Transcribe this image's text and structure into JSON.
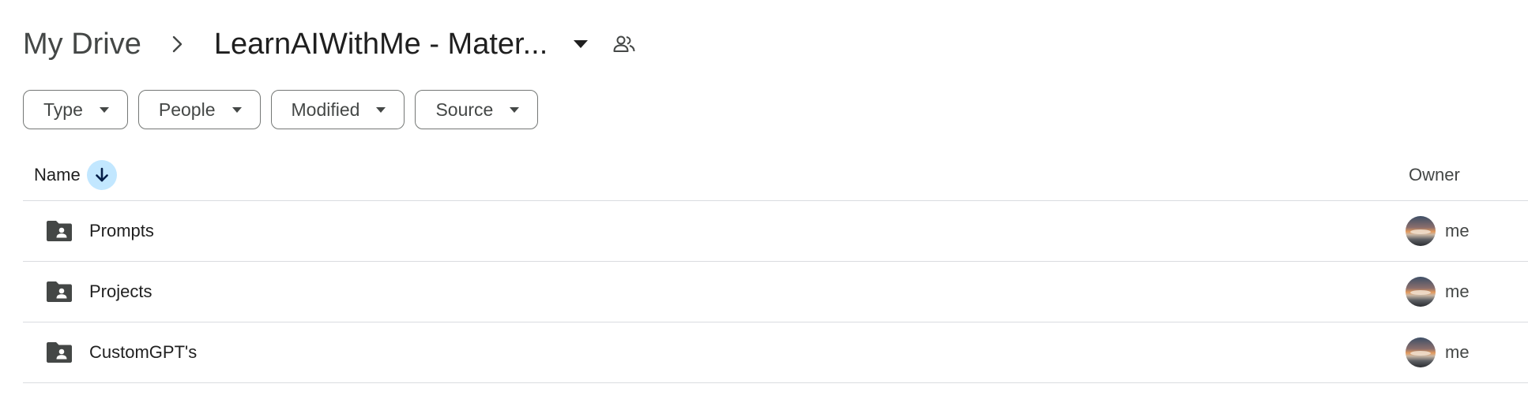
{
  "breadcrumb": {
    "root": "My Drive",
    "current": "LearnAIWithMe - Mater..."
  },
  "filters": [
    {
      "label": "Type"
    },
    {
      "label": "People"
    },
    {
      "label": "Modified"
    },
    {
      "label": "Source"
    }
  ],
  "table": {
    "headers": {
      "name": "Name",
      "owner": "Owner"
    },
    "sort": {
      "column": "Name",
      "direction": "descending",
      "icon": "arrow-down-icon"
    },
    "rows": [
      {
        "name": "Prompts",
        "type": "shared-folder",
        "owner": "me"
      },
      {
        "name": "Projects",
        "type": "shared-folder",
        "owner": "me"
      },
      {
        "name": "CustomGPT's",
        "type": "shared-folder",
        "owner": "me"
      }
    ]
  },
  "colors": {
    "sort_badge_bg": "#c2e7ff",
    "sort_badge_icon": "#041e49",
    "divider": "#dadce0",
    "folder_icon": "#444746"
  }
}
